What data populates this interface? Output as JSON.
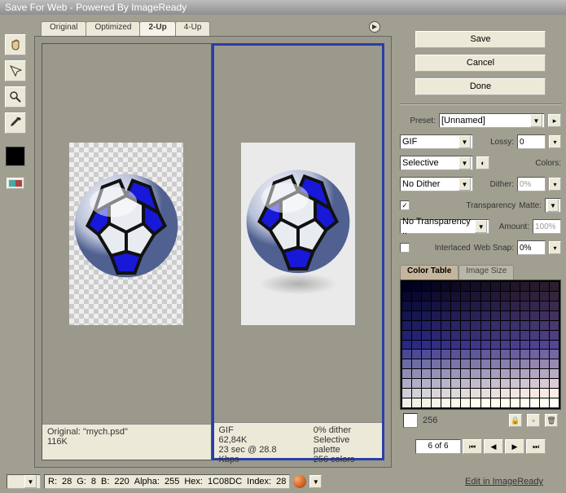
{
  "title": "Save For Web - Powered By ImageReady",
  "tabs": [
    "Original",
    "Optimized",
    "2-Up",
    "4-Up"
  ],
  "active_tab": "2-Up",
  "buttons": {
    "save": "Save",
    "cancel": "Cancel",
    "done": "Done"
  },
  "preset": {
    "label": "Preset:",
    "value": "[Unnamed]"
  },
  "settings": {
    "format": "GIF",
    "lossy_label": "Lossy:",
    "lossy_value": "0",
    "reduction": "Selective",
    "colors_label": "Colors:",
    "dither_method": "No Dither",
    "dither_label": "Dither:",
    "dither_value": "0%",
    "transparency_label": "Transparency",
    "matte_label": "Matte:",
    "transparency_dither": "No Transparency ..",
    "amount_label": "Amount:",
    "amount_value": "100%",
    "interlaced_label": "Interlaced",
    "websnap_label": "Web Snap:",
    "websnap_value": "0%"
  },
  "subtabs": {
    "colortable": "Color Table",
    "imagesize": "Image Size"
  },
  "ct_count": "256",
  "nav_text": "6 of 6",
  "pane_left": {
    "line1": "Original: \"mych.psd\"",
    "line2": "116K"
  },
  "pane_right": {
    "c1l1": "GIF",
    "c1l2": "62,84K",
    "c1l3": "23 sec @ 28.8 Kbps",
    "c2l1": "0% dither",
    "c2l2": "Selective palette",
    "c2l3": "256 colors"
  },
  "status": {
    "r": "R:",
    "rv": "28",
    "g": "G:",
    "gv": "8",
    "b": "B:",
    "bv": "220",
    "a": "Alpha:",
    "av": "255",
    "h": "Hex:",
    "hv": "1C08DC",
    "i": "Index:",
    "iv": "28"
  },
  "footer_link": "Edit in ImageReady",
  "icons": {
    "hand": "hand-icon",
    "marquee": "marquee-icon",
    "zoom": "zoom-icon",
    "eyedrop": "eyedropper-icon"
  }
}
